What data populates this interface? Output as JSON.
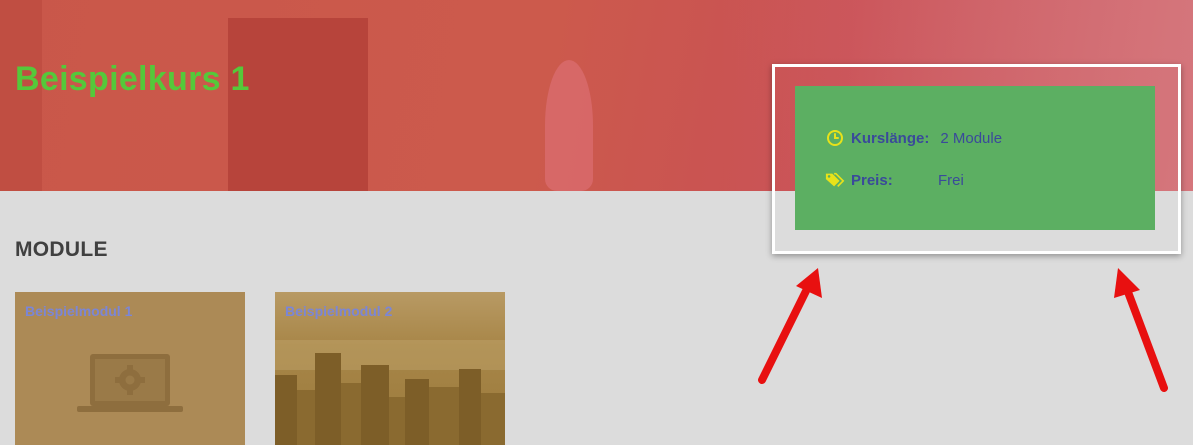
{
  "course": {
    "title": "Beispielkurs 1"
  },
  "info_card": {
    "length_label": "Kurslänge:",
    "length_value": "2 Module",
    "price_label": "Preis:",
    "price_value": "Frei",
    "icons": {
      "length": "clock-icon",
      "price": "tag-icon"
    }
  },
  "modules_section": {
    "title": "MODULE",
    "items": [
      {
        "title": "Beispielmodul 1",
        "image": "laptop-gear-icon"
      },
      {
        "title": "Beispielmodul 2",
        "image": "city-skyline-photo"
      }
    ]
  },
  "colors": {
    "title_green": "#55c83a",
    "card_green": "#5caf62",
    "label_blue": "#3a4a9a",
    "icon_yellow": "#e8e21a",
    "arrow_red": "#e81010"
  }
}
